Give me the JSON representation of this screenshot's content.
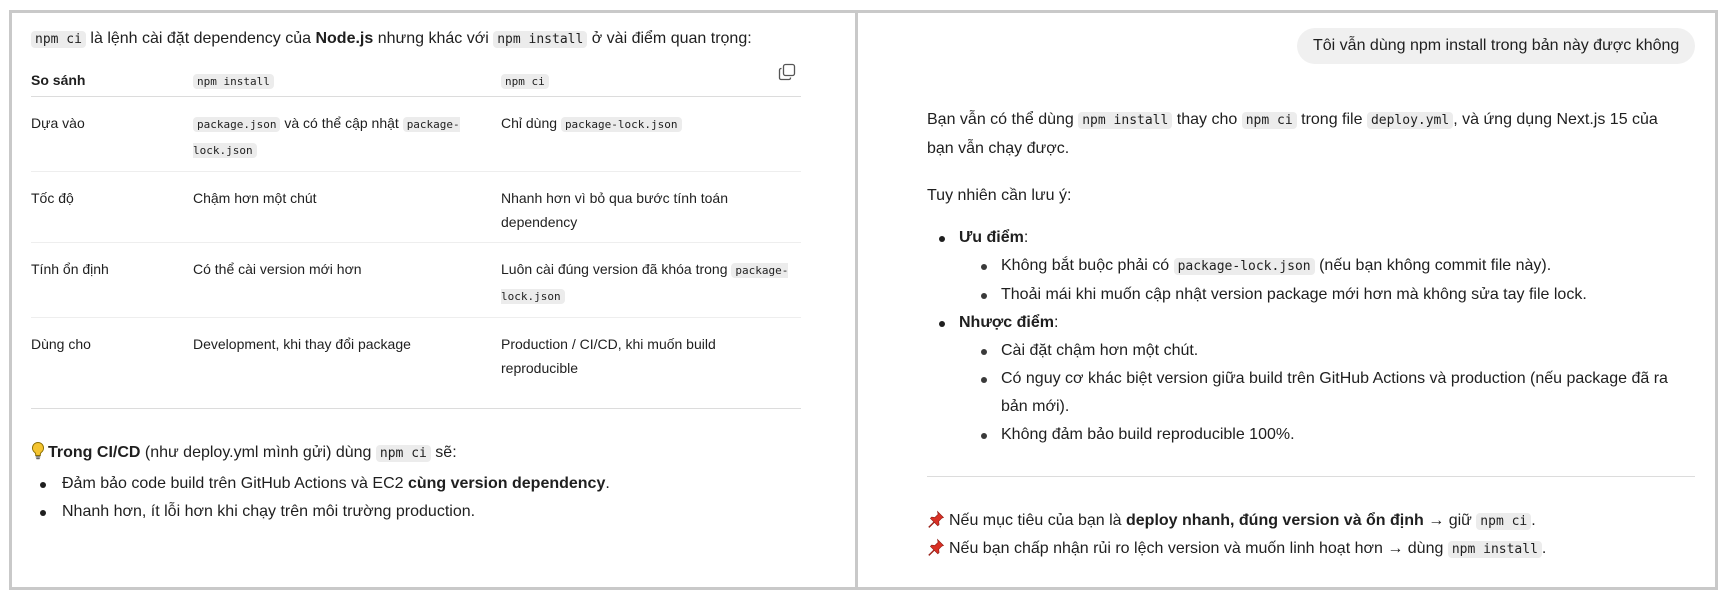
{
  "left": {
    "intro": {
      "cmd_ci": "npm ci",
      "t1": " là lệnh cài đặt dependency của ",
      "nodejs": "Node.js",
      "t2": " nhưng khác với ",
      "cmd_install": "npm install",
      "t3": " ở vài điểm quan trọng:"
    },
    "table": {
      "headers": [
        "So sánh",
        "npm install",
        "npm ci"
      ],
      "rows": [
        {
          "label": "Dựa vào",
          "install_code1": "package.json",
          "install_mid": " và có thể cập nhật ",
          "install_code2": "package-lock.json",
          "ci_text": "Chỉ dùng ",
          "ci_code": "package-lock.json"
        },
        {
          "label": "Tốc độ",
          "install": "Chậm hơn một chút",
          "ci": "Nhanh hơn vì bỏ qua bước tính toán dependency"
        },
        {
          "label": "Tính ổn định",
          "install": "Có thể cài version mới hơn",
          "ci_text": "Luôn cài đúng version đã khóa trong ",
          "ci_code": "package-lock.json"
        },
        {
          "label": "Dùng cho",
          "install": "Development, khi thay đổi package",
          "ci": "Production / CI/CD, khi muốn build reproducible"
        }
      ]
    },
    "tip": {
      "bold": "Trong CI/CD",
      "t1": " (như deploy.yml mình gửi) dùng ",
      "code": "npm ci",
      "t2": " sẽ:",
      "items": [
        {
          "text": "Đảm bảo code build trên GitHub Actions và EC2 ",
          "bold": "cùng version dependency",
          "end": "."
        },
        {
          "text": "Nhanh hơn, ít lỗi hơn khi chạy trên môi trường production."
        }
      ]
    }
  },
  "right": {
    "user_message": "Tôi vẫn dùng npm install trong bản này được không",
    "p1": {
      "t1": "Bạn vẫn có thể dùng ",
      "c1": "npm install",
      "t2": " thay cho ",
      "c2": "npm ci",
      "t3": " trong file ",
      "c3": "deploy.yml",
      "t4": ", và ứng dụng Next.js 15 của bạn vẫn chạy được."
    },
    "p2": "Tuy nhiên cần lưu ý:",
    "pros": {
      "title": "Ưu điểm",
      "colon": ":",
      "i1_t1": "Không bắt buộc phải có ",
      "i1_code": "package-lock.json",
      "i1_t2": " (nếu bạn không commit file này).",
      "i2": "Thoải mái khi muốn cập nhật version package mới hơn mà không sửa tay file lock."
    },
    "cons": {
      "title": "Nhược điểm",
      "colon": ":",
      "items": [
        "Cài đặt chậm hơn một chút.",
        "Có nguy cơ khác biệt version giữa build trên GitHub Actions và production (nếu package đã ra bản mới).",
        "Không đảm bảo build reproducible 100%."
      ]
    },
    "note1": {
      "t1": "Nếu mục tiêu của bạn là ",
      "bold": "deploy nhanh, đúng version và ổn định",
      "t2": " → giữ ",
      "code": "npm ci",
      "end": "."
    },
    "note2": {
      "t1": "Nếu bạn chấp nhận rủi ro lệch version và muốn linh hoạt hơn → dùng ",
      "code": "npm install",
      "end": "."
    }
  },
  "colors": {
    "border": "#c9c9c9",
    "code_bg": "#ececec",
    "bubble_bg": "#f0f0f0",
    "pin": "#d93025",
    "bulb": "#f4c430"
  }
}
